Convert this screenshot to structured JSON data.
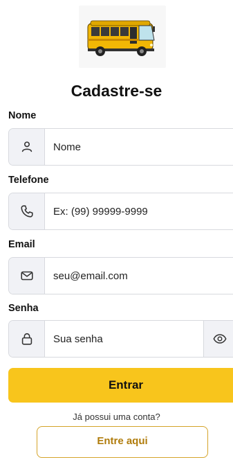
{
  "header": {
    "title": "Cadastre-se",
    "logo_icon": "bus-icon"
  },
  "form": {
    "name": {
      "label": "Nome",
      "placeholder": "Nome",
      "icon": "user-icon"
    },
    "phone": {
      "label": "Telefone",
      "placeholder": "Ex: (99) 99999-9999",
      "icon": "phone-icon"
    },
    "email": {
      "label": "Email",
      "placeholder": "seu@email.com",
      "icon": "mail-icon"
    },
    "password": {
      "label": "Senha",
      "placeholder": "Sua senha",
      "icon": "lock-icon",
      "toggle_icon": "eye-icon"
    }
  },
  "actions": {
    "submit_label": "Entrar",
    "login_prompt": "Já possui uma conta?",
    "login_label": "Entre aqui"
  },
  "colors": {
    "accent": "#f8c51c",
    "secondary_border": "#d4a328",
    "secondary_text": "#b07c0c",
    "icon_bg": "#f1f2f6"
  }
}
